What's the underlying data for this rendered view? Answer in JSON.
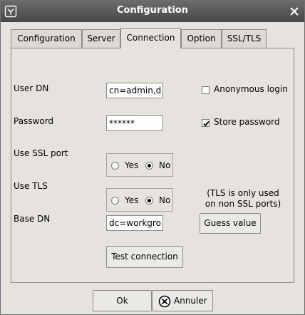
{
  "window": {
    "title": "Configuration"
  },
  "tabs": [
    {
      "label": "Configuration",
      "active": false
    },
    {
      "label": "Server",
      "active": false
    },
    {
      "label": "Connection",
      "active": true
    },
    {
      "label": "Option",
      "active": false
    },
    {
      "label": "SSL/TLS",
      "active": false
    }
  ],
  "form": {
    "user_dn": {
      "label": "User DN",
      "value": "cn=admin,d"
    },
    "password": {
      "label": "Password",
      "value": "******"
    },
    "use_ssl_port": {
      "label": "Use SSL port",
      "yes": "Yes",
      "no": "No",
      "selected": "No"
    },
    "use_tls": {
      "label": "Use TLS",
      "yes": "Yes",
      "no": "No",
      "selected": "No"
    },
    "base_dn": {
      "label": "Base DN",
      "value": "dc=workgro"
    },
    "anonymous_login": {
      "label": "Anonymous login",
      "checked": false
    },
    "store_password": {
      "label": "Store password",
      "checked": true
    },
    "tls_note_line1": "(TLS is only used",
    "tls_note_line2": "on non SSL ports)",
    "guess_value_label": "Guess value",
    "test_connection_label": "Test connection"
  },
  "footer": {
    "ok_label": "Ok",
    "cancel_label": "Annuler"
  }
}
